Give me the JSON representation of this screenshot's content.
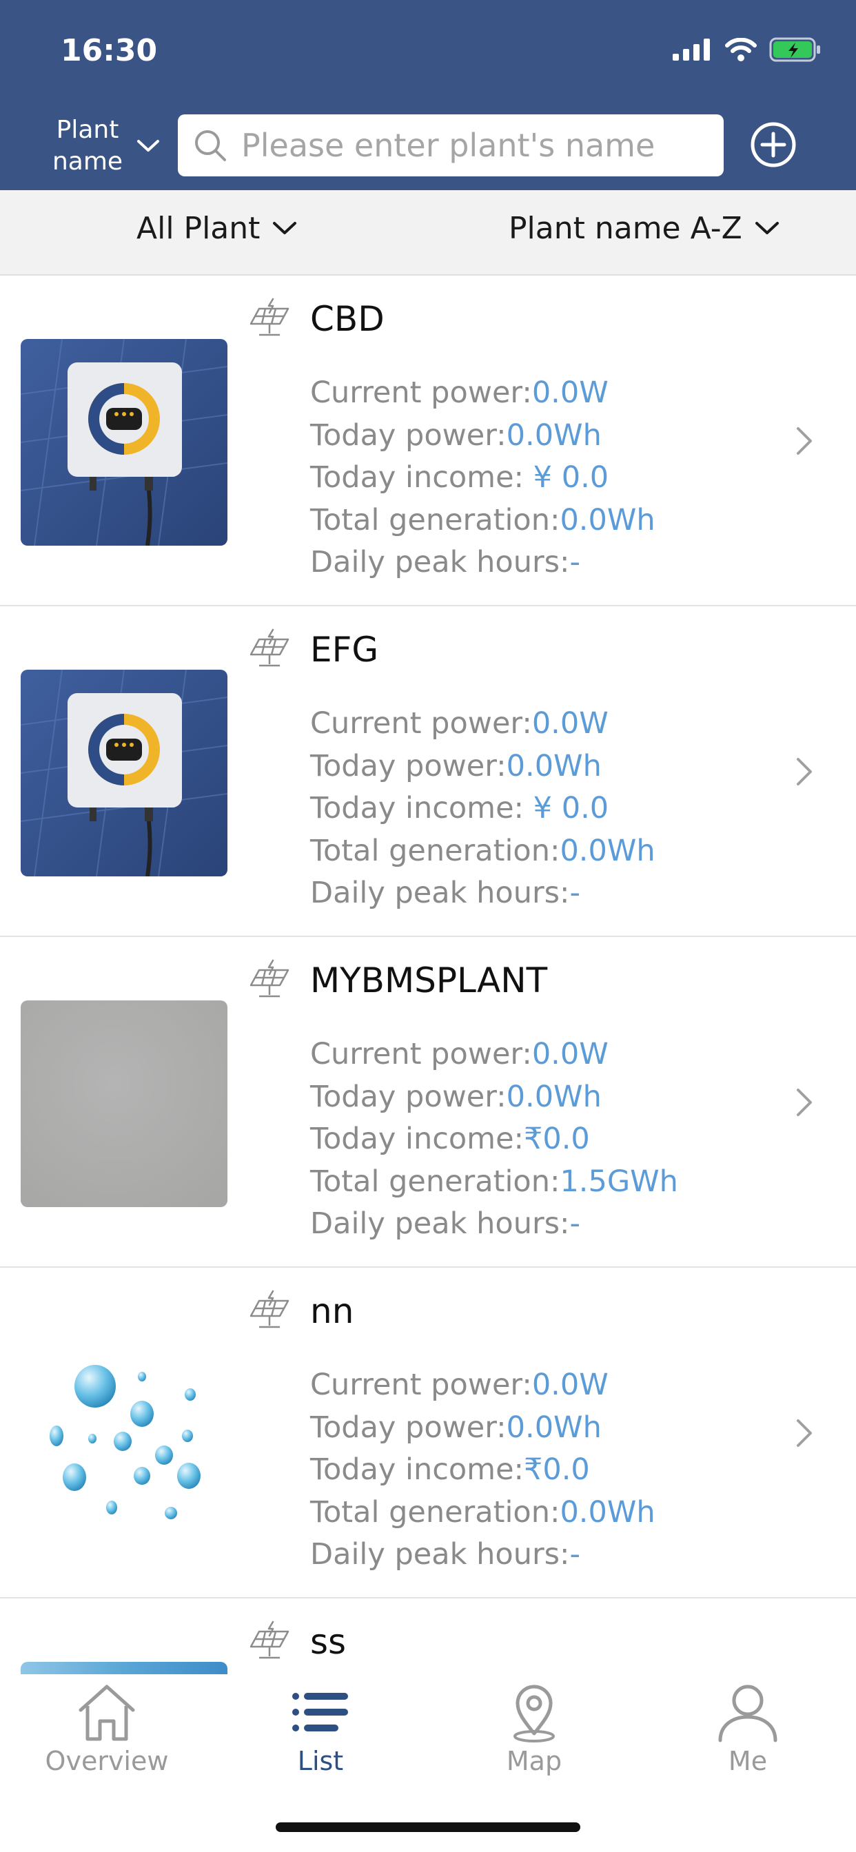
{
  "status_bar": {
    "time": "16:30"
  },
  "search": {
    "type_label": "Plant name",
    "placeholder": "Please enter plant's name"
  },
  "filters": {
    "plant_filter": "All Plant",
    "sort": "Plant name A-Z"
  },
  "metric_labels": {
    "current_power": "Current power:",
    "today_power": "Today power:",
    "today_income": "Today income:",
    "total_generation": "Total generation:",
    "daily_peak_hours": "Daily peak hours:"
  },
  "plants": [
    {
      "name": "CBD",
      "image": "inverter-photo",
      "current_power": "0.0W",
      "today_power": "0.0Wh",
      "today_income": " ¥ 0.0",
      "total_generation": "0.0Wh",
      "daily_peak_hours": "-"
    },
    {
      "name": "EFG",
      "image": "inverter-photo",
      "current_power": "0.0W",
      "today_power": "0.0Wh",
      "today_income": " ¥ 0.0",
      "total_generation": "0.0Wh",
      "daily_peak_hours": "-"
    },
    {
      "name": "MYBMSPLANT",
      "image": "gray-photo",
      "current_power": "0.0W",
      "today_power": "0.0Wh",
      "today_income": "₹0.0",
      "total_generation": "1.5GWh",
      "daily_peak_hours": "-"
    },
    {
      "name": "nn",
      "image": "water-drops-photo",
      "current_power": "0.0W",
      "today_power": "0.0Wh",
      "today_income": "₹0.0",
      "total_generation": "0.0Wh",
      "daily_peak_hours": "-"
    },
    {
      "name": "ss",
      "image": "blue-photo"
    }
  ],
  "tabs": [
    {
      "label": "Overview",
      "icon": "home-icon",
      "active": false
    },
    {
      "label": "List",
      "icon": "list-icon",
      "active": true
    },
    {
      "label": "Map",
      "icon": "map-pin-icon",
      "active": false
    },
    {
      "label": "Me",
      "icon": "person-icon",
      "active": false
    }
  ],
  "colors": {
    "header_bg": "#3a5585",
    "value_blue": "#5b9bd8",
    "active_tab": "#2d4f82"
  }
}
